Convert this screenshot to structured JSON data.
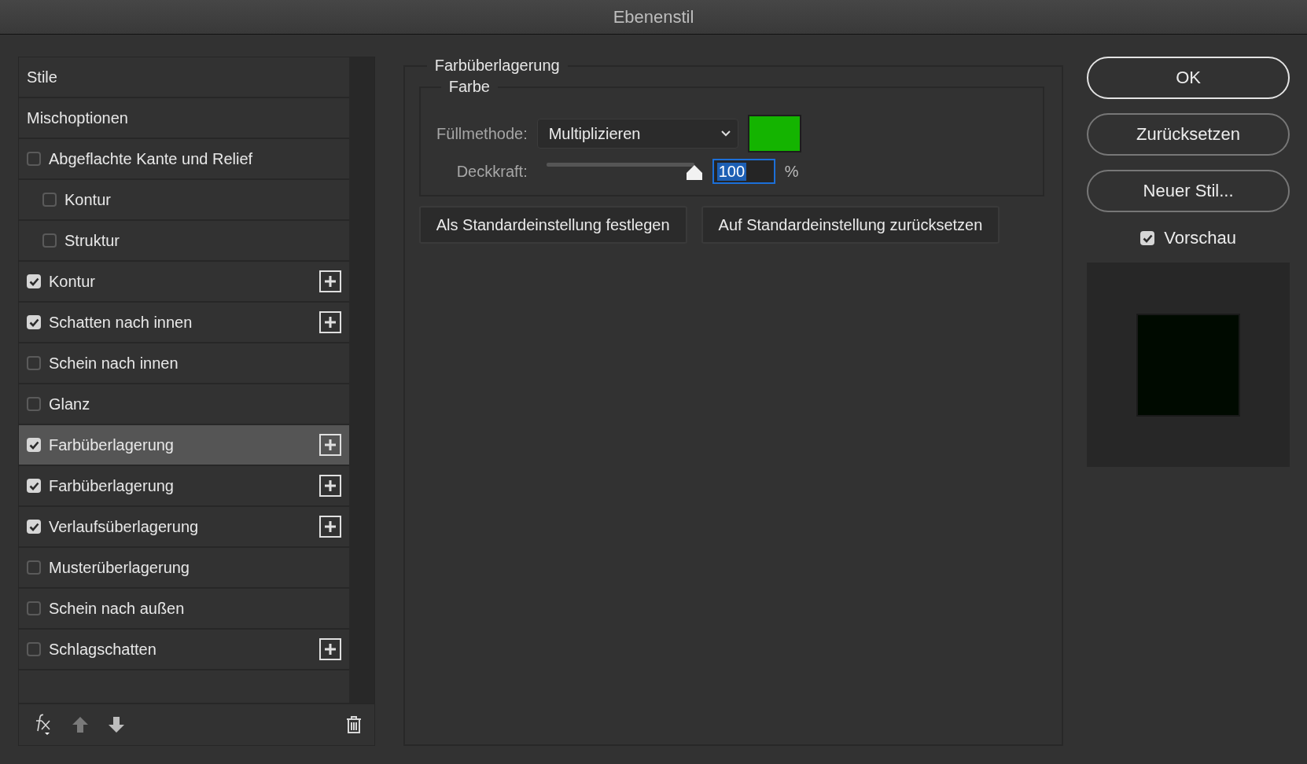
{
  "window": {
    "title": "Ebenenstil"
  },
  "styles": [
    {
      "label": "Stile",
      "kind": "plain",
      "selected": false
    },
    {
      "label": "Mischoptionen",
      "kind": "plain",
      "selected": false
    },
    {
      "label": "Abgeflachte Kante und Relief",
      "kind": "option",
      "checked": false,
      "selected": false,
      "addable": false,
      "children": [
        {
          "label": "Kontur",
          "kind": "option",
          "checked": false,
          "selected": false,
          "addable": false
        },
        {
          "label": "Struktur",
          "kind": "option",
          "checked": false,
          "selected": false,
          "addable": false
        }
      ]
    },
    {
      "label": "Kontur",
      "kind": "option",
      "checked": true,
      "selected": false,
      "addable": true
    },
    {
      "label": "Schatten nach innen",
      "kind": "option",
      "checked": true,
      "selected": false,
      "addable": true
    },
    {
      "label": "Schein nach innen",
      "kind": "option",
      "checked": false,
      "selected": false,
      "addable": false
    },
    {
      "label": "Glanz",
      "kind": "option",
      "checked": false,
      "selected": false,
      "addable": false
    },
    {
      "label": "Farbüberlagerung",
      "kind": "option",
      "checked": true,
      "selected": true,
      "addable": true
    },
    {
      "label": "Farbüberlagerung",
      "kind": "option",
      "checked": true,
      "selected": false,
      "addable": true
    },
    {
      "label": "Verlaufsüberlagerung",
      "kind": "option",
      "checked": true,
      "selected": false,
      "addable": true
    },
    {
      "label": "Musterüberlagerung",
      "kind": "option",
      "checked": false,
      "selected": false,
      "addable": false
    },
    {
      "label": "Schein nach außen",
      "kind": "option",
      "checked": false,
      "selected": false,
      "addable": false
    },
    {
      "label": "Schlagschatten",
      "kind": "option",
      "checked": false,
      "selected": false,
      "addable": true
    }
  ],
  "settings": {
    "title": "Farbüberlagerung",
    "group": "Farbe",
    "fill_method": {
      "label": "Füllmethode:",
      "value": "Multiplizieren"
    },
    "color": "#14b400",
    "opacity": {
      "label": "Deckkraft:",
      "level": 1,
      "value": "100",
      "unit": "%"
    },
    "buttons": [
      "Als Standardeinstellung festlegen",
      "Auf Standardeinstellung zurücksetzen"
    ]
  },
  "actions": [
    {
      "label": "OK",
      "default": true
    },
    {
      "label": "Zurücksetzen",
      "default": false
    },
    {
      "label": "Neuer Stil...",
      "default": false
    }
  ],
  "preview": {
    "label": "Vorschau",
    "checked": true
  }
}
